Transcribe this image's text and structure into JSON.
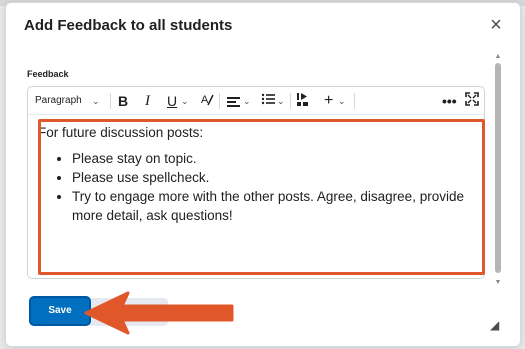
{
  "dialog": {
    "title": "Add Feedback to all students",
    "close_symbol": "×"
  },
  "feedback": {
    "label": "Feedback",
    "toolbar": {
      "paragraph_label": "Paragraph",
      "bold_label": "B",
      "italic_label": "I",
      "underline_label": "U",
      "strike_label": "A/",
      "insert_label": "+",
      "more_label": "•••",
      "chevron": "⌄"
    },
    "content": {
      "intro": "For future discussion posts:",
      "bullets": [
        "Please stay on topic.",
        "Please use spellcheck.",
        "Try to engage more with the other posts. Agree, disagree, provide more detail, ask questions!"
      ]
    }
  },
  "footer": {
    "save_label": "Save"
  },
  "colors": {
    "accent": "#006fbf",
    "annotation": "#e0582a"
  },
  "icons": {
    "close": "close-icon",
    "align": "align-icon",
    "list": "bulleted-list-icon",
    "media": "insert-media-icon",
    "fullscreen": "fullscreen-icon"
  }
}
